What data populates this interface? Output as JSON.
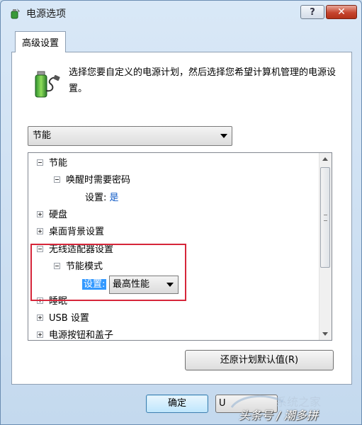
{
  "window": {
    "title": "电源选项",
    "help_label": "?",
    "close_label": "✕"
  },
  "tab": {
    "label": "高级设置"
  },
  "description": "选择您要自定义的电源计划，然后选择您希望计算机管理的电源设置。",
  "plan_select": {
    "value": "节能"
  },
  "tree": {
    "items": [
      {
        "label": "节能"
      },
      {
        "label": "唤醒时需要密码"
      },
      {
        "setting_label": "设置:",
        "setting_value": "是"
      },
      {
        "label": "硬盘"
      },
      {
        "label": "桌面背景设置"
      },
      {
        "label": "无线适配器设置"
      },
      {
        "label": "节能模式"
      },
      {
        "setting_label": "设置:",
        "setting_value": "最高性能"
      },
      {
        "label": "睡眠"
      },
      {
        "label": "USB 设置"
      },
      {
        "label": "电源按钮和盖子"
      }
    ]
  },
  "buttons": {
    "restore": "还原计划默认值(R)",
    "ok": "确定",
    "cancel": "U"
  },
  "watermark": {
    "text": "头条号 / 潮多拼",
    "brand": "系统之家"
  },
  "colors": {
    "highlight_box": "#d6263a",
    "selection": "#3399ff",
    "link_value": "#0b57c5"
  }
}
